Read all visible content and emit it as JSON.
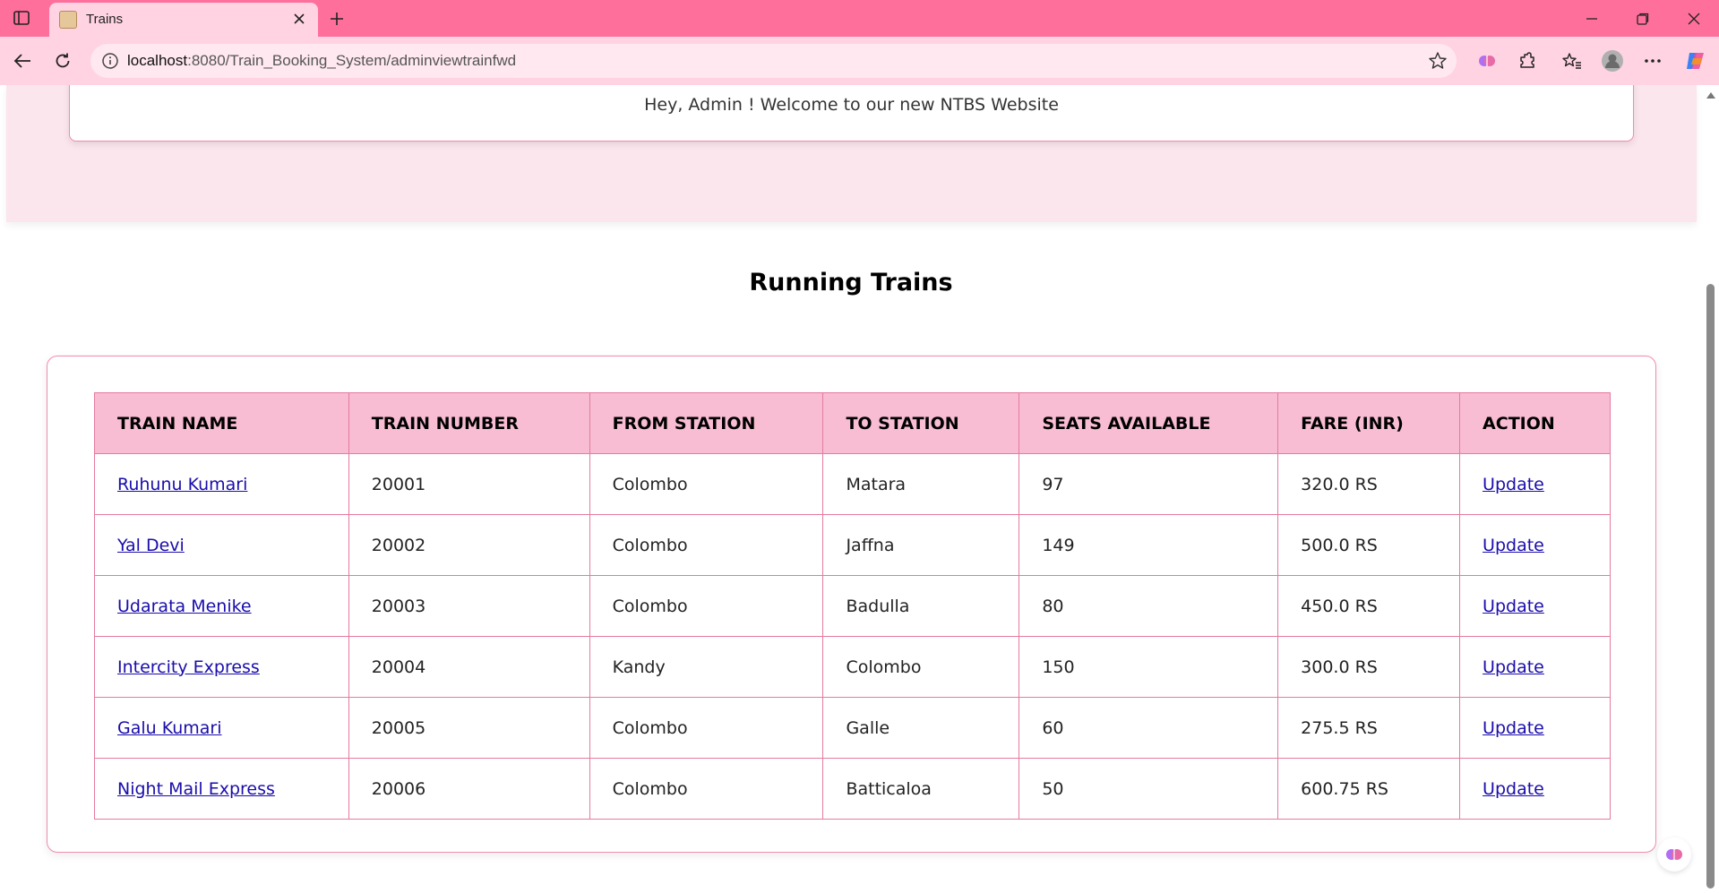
{
  "browser": {
    "tab": {
      "title": "Trains",
      "favicon": "train-favicon-icon"
    },
    "address": {
      "host": "localhost",
      "path": ":8080/Train_Booking_System/adminviewtrainfwd"
    },
    "colors": {
      "titlebar": "#ff6f9c",
      "toolbar": "#ffd3e2",
      "tab_active": "#ffd3e2"
    }
  },
  "page": {
    "welcome": "Hey, Admin ! Welcome to our new NTBS Website",
    "heading": "Running Trains",
    "table": {
      "headers": [
        "TRAIN NAME",
        "TRAIN NUMBER",
        "FROM STATION",
        "TO STATION",
        "SEATS AVAILABLE",
        "FARE (INR)",
        "ACTION"
      ],
      "rows": [
        {
          "name": "Ruhunu Kumari",
          "number": "20001",
          "from": "Colombo",
          "to": "Matara",
          "seats": "97",
          "fare": "320.0 RS",
          "action": "Update"
        },
        {
          "name": "Yal Devi",
          "number": "20002",
          "from": "Colombo",
          "to": "Jaffna",
          "seats": "149",
          "fare": "500.0 RS",
          "action": "Update"
        },
        {
          "name": "Udarata Menike",
          "number": "20003",
          "from": "Colombo",
          "to": "Badulla",
          "seats": "80",
          "fare": "450.0 RS",
          "action": "Update"
        },
        {
          "name": "Intercity Express",
          "number": "20004",
          "from": "Kandy",
          "to": "Colombo",
          "seats": "150",
          "fare": "300.0 RS",
          "action": "Update"
        },
        {
          "name": "Galu Kumari",
          "number": "20005",
          "from": "Colombo",
          "to": "Galle",
          "seats": "60",
          "fare": "275.5 RS",
          "action": "Update"
        },
        {
          "name": "Night Mail Express",
          "number": "20006",
          "from": "Colombo",
          "to": "Batticaloa",
          "seats": "50",
          "fare": "600.75 RS",
          "action": "Update"
        }
      ]
    },
    "colors": {
      "header_bg": "#f8bdd2",
      "border": "#e57aa0",
      "band": "#fce6ee",
      "link": "#1a0dab"
    }
  }
}
